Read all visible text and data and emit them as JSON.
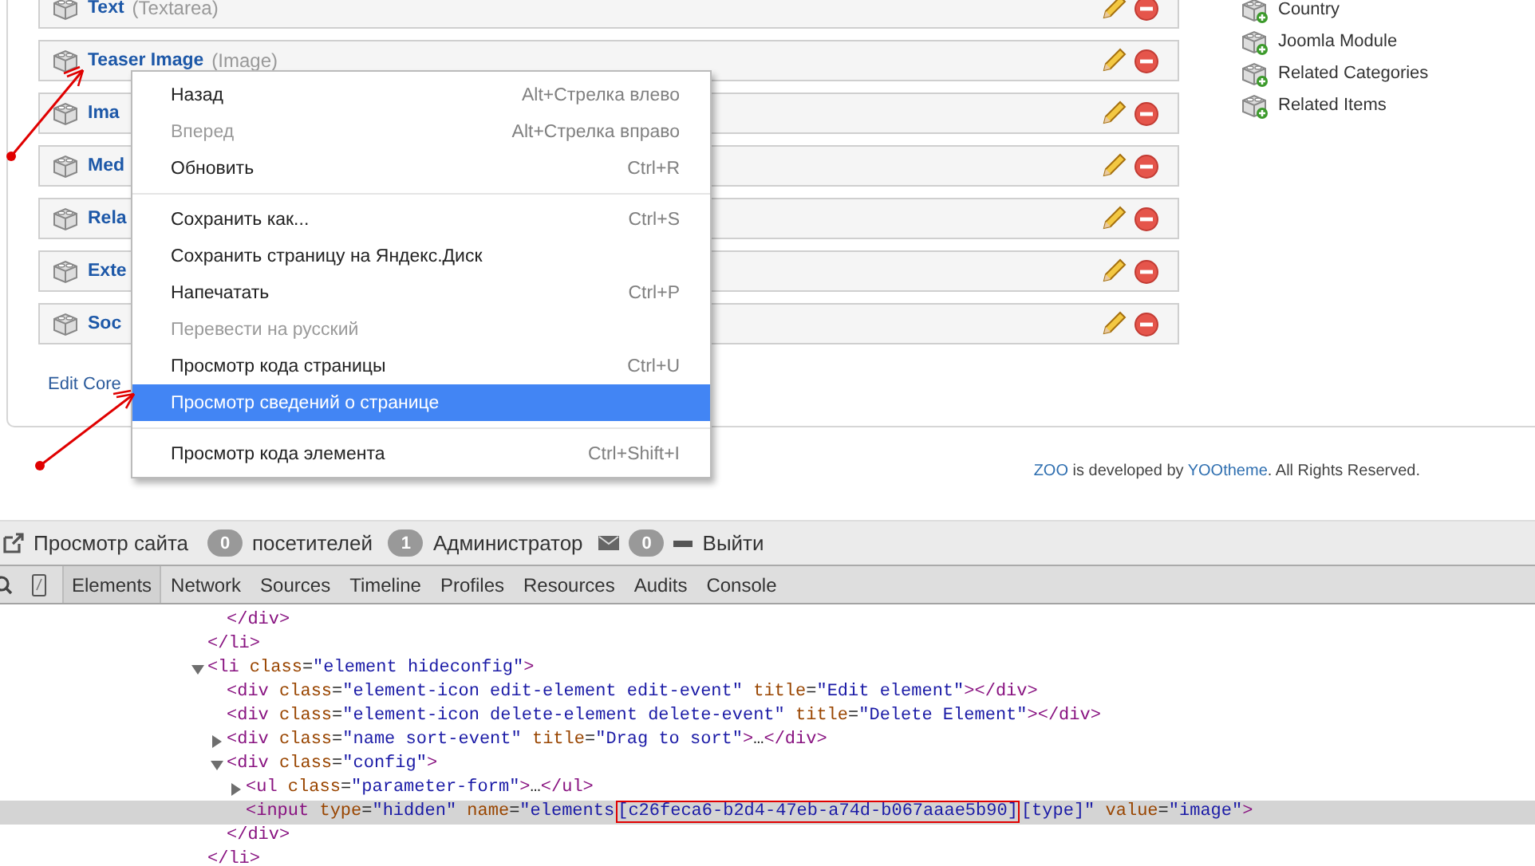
{
  "elements": [
    {
      "name": "Text",
      "type": "(Textarea)"
    },
    {
      "name": "Teaser Image",
      "type": "(Image)"
    },
    {
      "name": "Ima"
    },
    {
      "name": "Med"
    },
    {
      "name": "Rela"
    },
    {
      "name": "Exte"
    },
    {
      "name": "Soc"
    }
  ],
  "edit_link": "Edit Core",
  "add_elements": [
    "Country",
    "Joomla Module",
    "Related Categories",
    "Related Items"
  ],
  "footer": [
    {
      "text": "ZOO",
      "link": true
    },
    {
      "text": " is developed by ",
      "link": false
    },
    {
      "text": "YOOtheme",
      "link": true
    },
    {
      "text": ". All Rights Reserved.",
      "link": false
    }
  ],
  "context_menu": [
    {
      "kind": "item",
      "label": "Назад",
      "shortcut": "Alt+Стрелка влево",
      "disabled": false,
      "selected": false
    },
    {
      "kind": "item",
      "label": "Вперед",
      "shortcut": "Alt+Стрелка вправо",
      "disabled": true,
      "selected": false
    },
    {
      "kind": "item",
      "label": "Обновить",
      "shortcut": "Ctrl+R",
      "disabled": false,
      "selected": false
    },
    {
      "kind": "separator"
    },
    {
      "kind": "item",
      "label": "Сохранить как...",
      "shortcut": "Ctrl+S",
      "disabled": false,
      "selected": false
    },
    {
      "kind": "item",
      "label": "Сохранить страницу на Яндекс.Диск",
      "disabled": false,
      "selected": false
    },
    {
      "kind": "item",
      "label": "Напечатать",
      "shortcut": "Ctrl+P",
      "disabled": false,
      "selected": false
    },
    {
      "kind": "item",
      "label": "Перевести на русский",
      "disabled": true,
      "selected": false
    },
    {
      "kind": "item",
      "label": "Просмотр кода страницы",
      "shortcut": "Ctrl+U",
      "disabled": false,
      "selected": false
    },
    {
      "kind": "item",
      "label": "Просмотр сведений о странице",
      "disabled": false,
      "selected": true
    },
    {
      "kind": "separator"
    },
    {
      "kind": "item",
      "label": "Просмотр кода элемента",
      "shortcut": "Ctrl+Shift+I",
      "disabled": false,
      "selected": false
    }
  ],
  "admin_bar": [
    {
      "kind": "link",
      "label": "Просмотр сайта"
    },
    {
      "kind": "count",
      "count": "0",
      "label": "посетителей"
    },
    {
      "kind": "count",
      "count": "1",
      "label": "Администратор"
    },
    {
      "kind": "mail",
      "count": "0"
    },
    {
      "kind": "logout",
      "label": "Выйти"
    }
  ],
  "devtools": {
    "tabs": [
      {
        "label": "Elements",
        "selected": true
      },
      {
        "label": "Network",
        "selected": false
      },
      {
        "label": "Sources",
        "selected": false
      },
      {
        "label": "Timeline",
        "selected": false
      },
      {
        "label": "Profiles",
        "selected": false
      },
      {
        "label": "Resources",
        "selected": false
      },
      {
        "label": "Audits",
        "selected": false
      },
      {
        "label": "Console",
        "selected": false
      }
    ],
    "dom": [
      {
        "children": [
          {
            "text": "</div>"
          }
        ],
        "close": "</li>"
      },
      {
        "text": "<li class=\"element hideconfig\">",
        "expanded": true,
        "close": "</li>",
        "children": [
          {
            "text": "<div class=\"element-icon edit-element edit-event\" title=\"Edit element\"></div>"
          },
          {
            "text": "<div class=\"element-icon delete-element delete-event\" title=\"Delete Element\"></div>"
          },
          {
            "text": "<div class=\"name sort-event\" title=\"Drag to sort\">…</div>",
            "expanded": false
          },
          {
            "text": "<div class=\"config\">",
            "expanded": true,
            "close": "</div>",
            "children": [
              {
                "text": "<ul class=\"parameter-form\">…</ul>",
                "expanded": false
              },
              {
                "selected": true,
                "segments": [
                  {
                    "text": "<input type=\"hidden\" name=\"elements",
                    "boxed": false
                  },
                  {
                    "text": "[c26feca6-b2d4-47eb-a74d-b067aaae5b90]",
                    "boxed": true
                  },
                  {
                    "text": "[type]\" value=\"image\">",
                    "boxed": false
                  }
                ]
              }
            ]
          }
        ]
      }
    ]
  }
}
